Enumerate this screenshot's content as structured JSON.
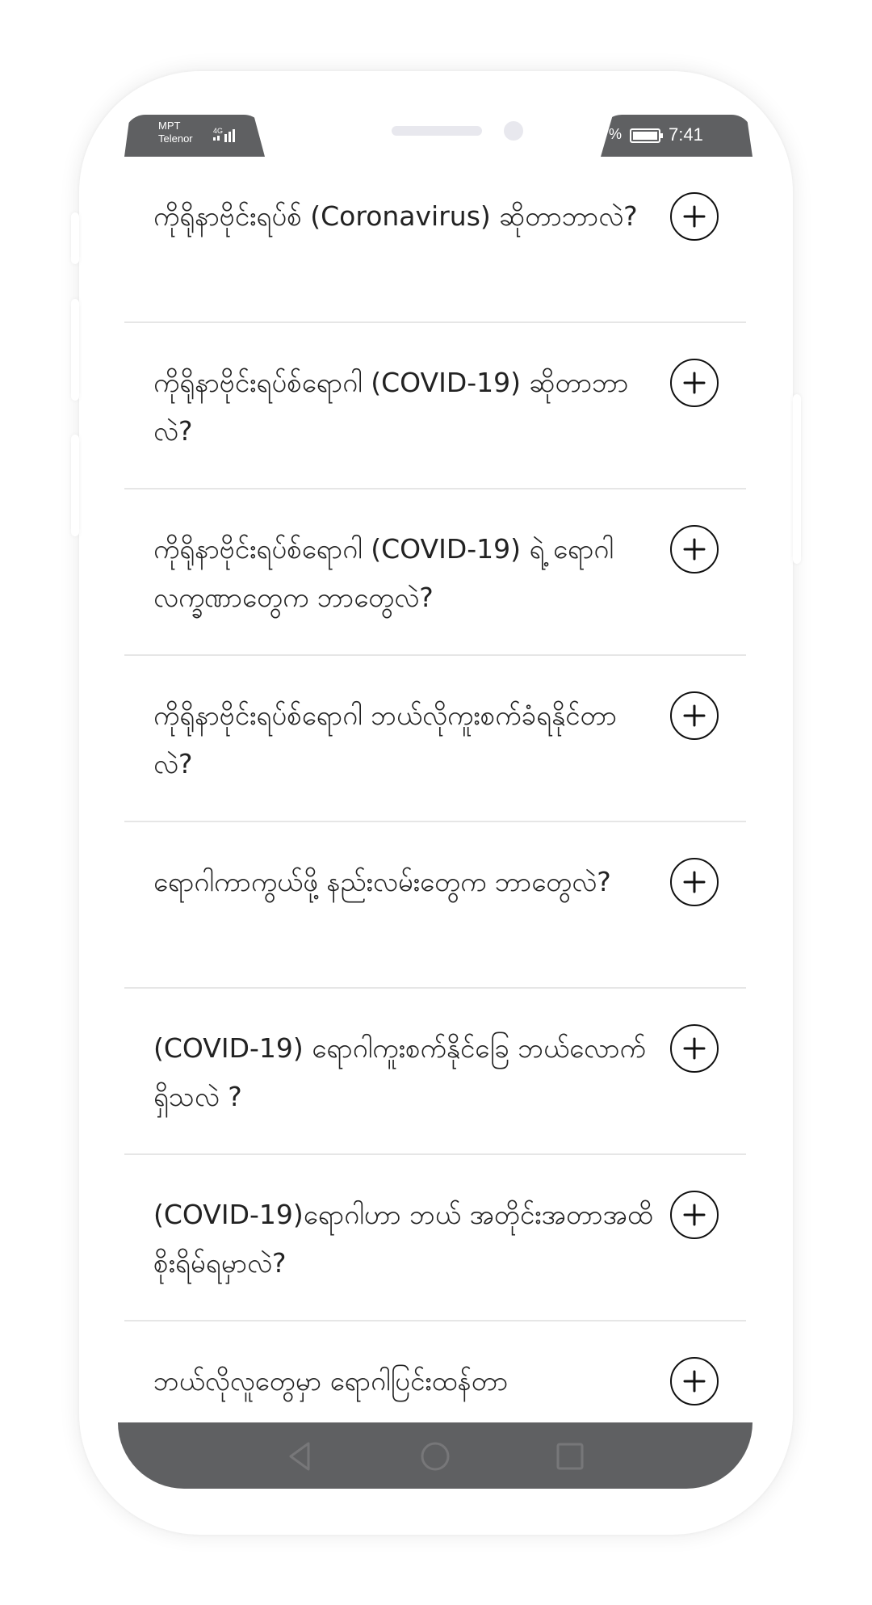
{
  "status_bar": {
    "carrier_primary": "MPT",
    "carrier_secondary": "Telenor",
    "network_type": "4G",
    "battery_percent_fragment": "%",
    "time": "7:41",
    "icons": [
      "signal-icon",
      "battery-icon"
    ]
  },
  "faq": {
    "items": [
      {
        "question": "ကိုရိုနာဗိုင်းရပ်စ် (Coronavirus) ဆိုတာဘာလဲ?",
        "toggle": "plus-icon"
      },
      {
        "question": "ကိုရိုနာဗိုင်းရပ်စ်ရောဂါ (COVID-19) ဆိုတာဘာလဲ?",
        "toggle": "plus-icon"
      },
      {
        "question": "ကိုရိုနာဗိုင်းရပ်စ်ရောဂါ (COVID-19) ရဲ့ ရောဂါလက္ခဏာတွေက ဘာတွေလဲ?",
        "toggle": "plus-icon"
      },
      {
        "question": "ကိုရိုနာဗိုင်းရပ်စ်ရောဂါ ဘယ်လိုကူးစက်ခံရနိုင်တာလဲ?",
        "toggle": "plus-icon"
      },
      {
        "question": "ရောဂါကာကွယ်ဖို့ နည်းလမ်းတွေက ဘာတွေလဲ?",
        "toggle": "plus-icon"
      },
      {
        "question": "(COVID-19) ရောဂါကူးစက်နိုင်ခြေ ဘယ်လောက်ရှိသလဲ ?",
        "toggle": "plus-icon"
      },
      {
        "question": "(COVID-19)ရောဂါဟာ ဘယ် အတိုင်းအတာအထိ စိုးရိမ်ရမှာလဲ?",
        "toggle": "plus-icon"
      },
      {
        "question": "ဘယ်လိုလူတွေမှာ ရောဂါပြင်းထန်တာ",
        "toggle": "plus-icon"
      }
    ]
  },
  "nav_bar": {
    "buttons": [
      "back-icon",
      "home-icon",
      "recents-icon"
    ]
  },
  "colors": {
    "bar": "#5f6062",
    "divider": "#e6e6e6",
    "text": "#222222",
    "nav_icon": "#777779"
  }
}
